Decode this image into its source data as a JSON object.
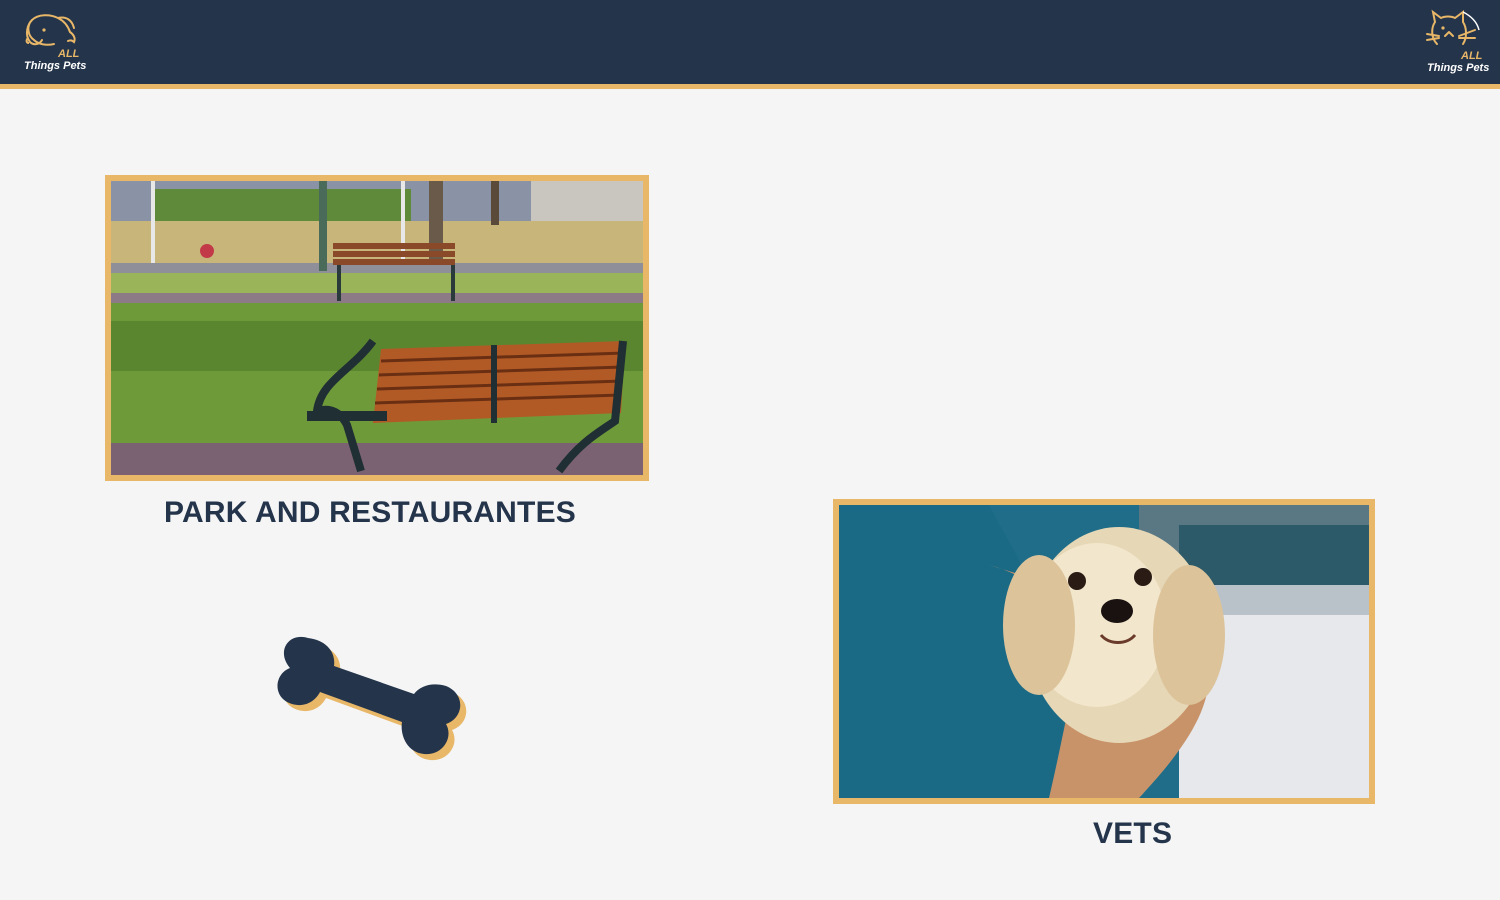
{
  "header": {
    "logo_left": {
      "line1": "ALL",
      "line2": "Things Pets",
      "icon": "dog-head-icon"
    },
    "logo_right": {
      "line1": "ALL",
      "line2": "Things Pets",
      "icon": "cat-head-icon"
    }
  },
  "cards": [
    {
      "caption": "PARK AND RESTAURANTES",
      "image": "park-bench-photo"
    },
    {
      "caption": "VETS",
      "image": "dog-at-vet-photo"
    }
  ],
  "decoration": {
    "icon": "bone-icon"
  },
  "colors": {
    "header_bg": "#24344b",
    "accent": "#e8b768",
    "page_bg": "#f5f5f5",
    "caption_text": "#24344b"
  }
}
